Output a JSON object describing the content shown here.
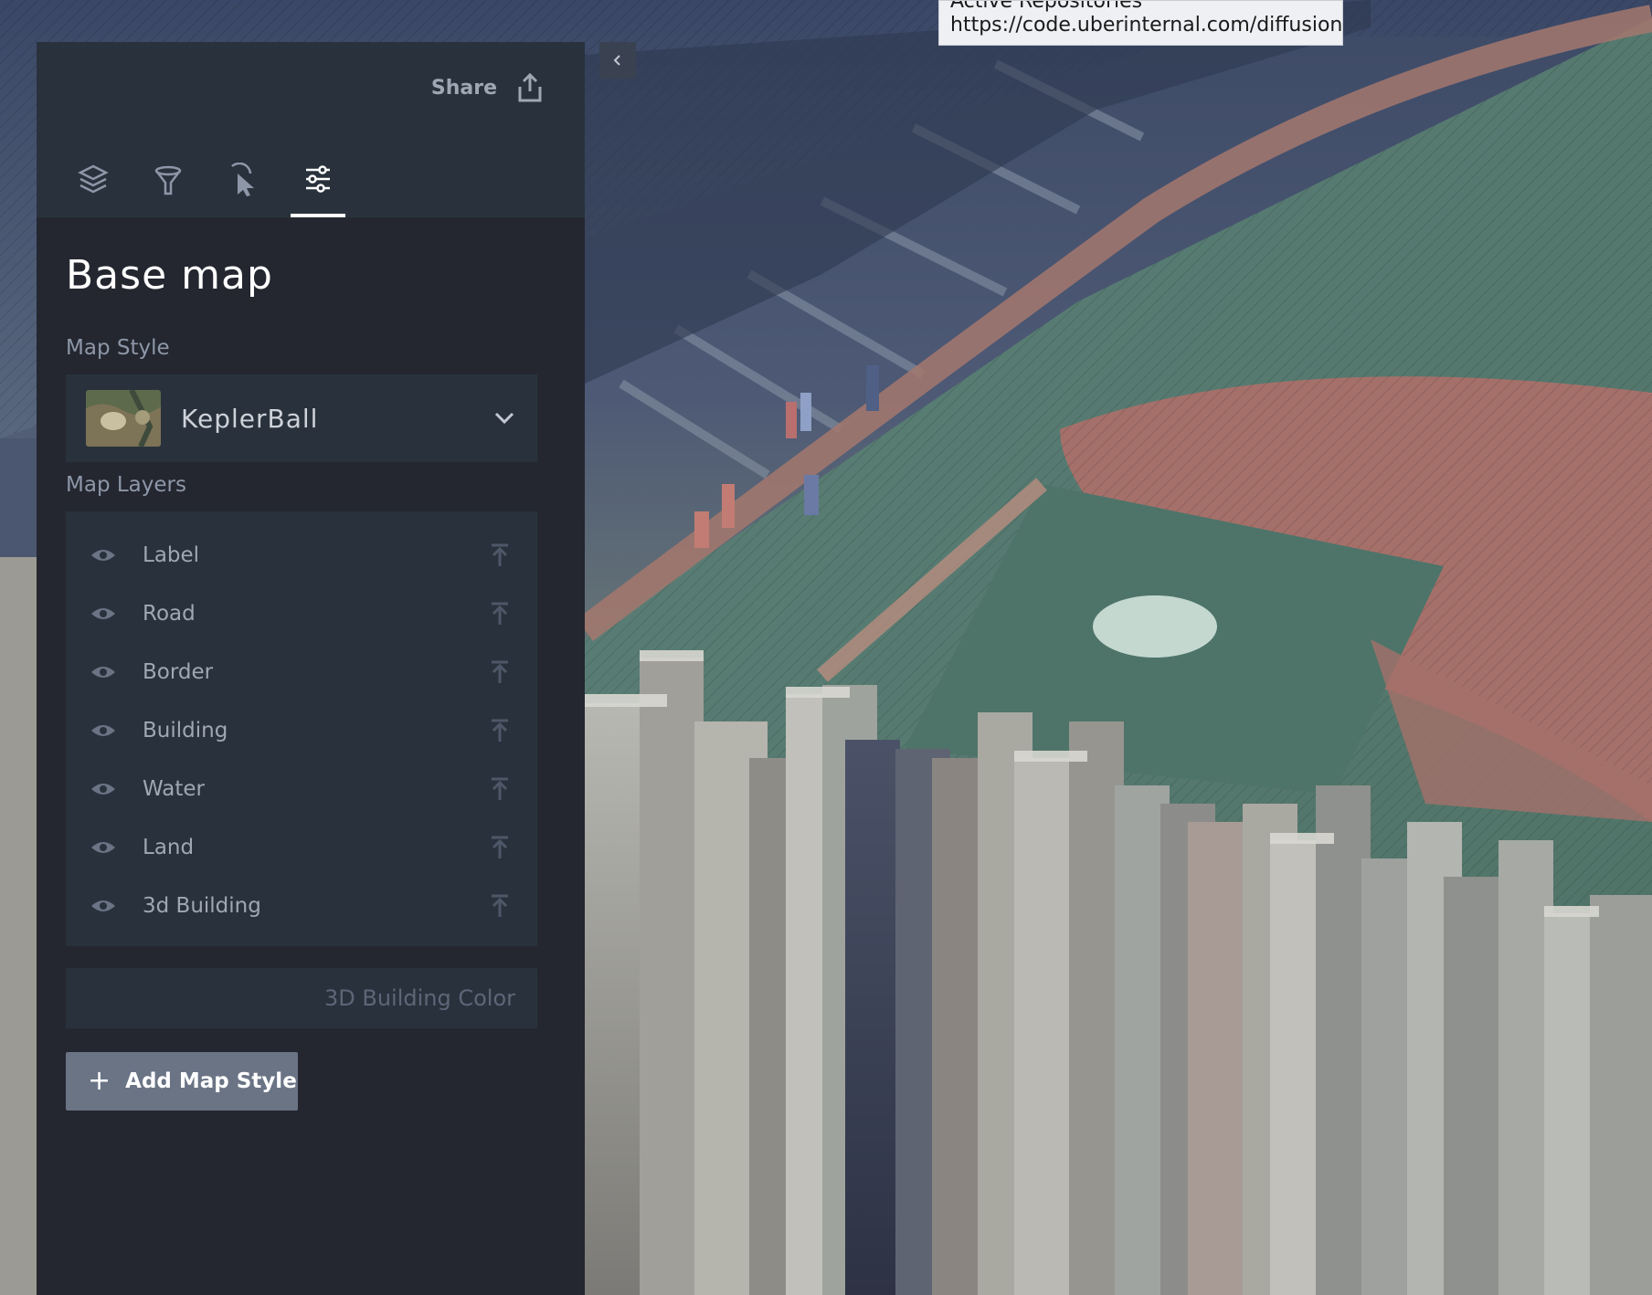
{
  "tooltip": {
    "title": "Active Repositories",
    "url": "https://code.uberinternal.com/diffusion/"
  },
  "header": {
    "share_label": "Share"
  },
  "tabs": [
    {
      "name": "layers",
      "icon": "layers-icon",
      "active": false
    },
    {
      "name": "filters",
      "icon": "filter-icon",
      "active": false
    },
    {
      "name": "interactions",
      "icon": "cursor-icon",
      "active": false
    },
    {
      "name": "basemap",
      "icon": "sliders-icon",
      "active": true
    }
  ],
  "panel": {
    "title": "Base map",
    "map_style_label": "Map Style",
    "map_style_value": "KeplerBall",
    "map_layers_label": "Map Layers",
    "layers": [
      {
        "label": "Label",
        "visible": true
      },
      {
        "label": "Road",
        "visible": true
      },
      {
        "label": "Border",
        "visible": true
      },
      {
        "label": "Building",
        "visible": true
      },
      {
        "label": "Water",
        "visible": true
      },
      {
        "label": "Land",
        "visible": true
      },
      {
        "label": "3d Building",
        "visible": true
      }
    ],
    "building_color_label": "3D Building Color",
    "add_style_label": "Add Map Style"
  },
  "colors": {
    "panel_bg": "#242730",
    "panel_header_bg": "#29323c",
    "accent": "#ffffff",
    "muted_text": "#a0a7b4",
    "button_bg": "#6a7485"
  }
}
